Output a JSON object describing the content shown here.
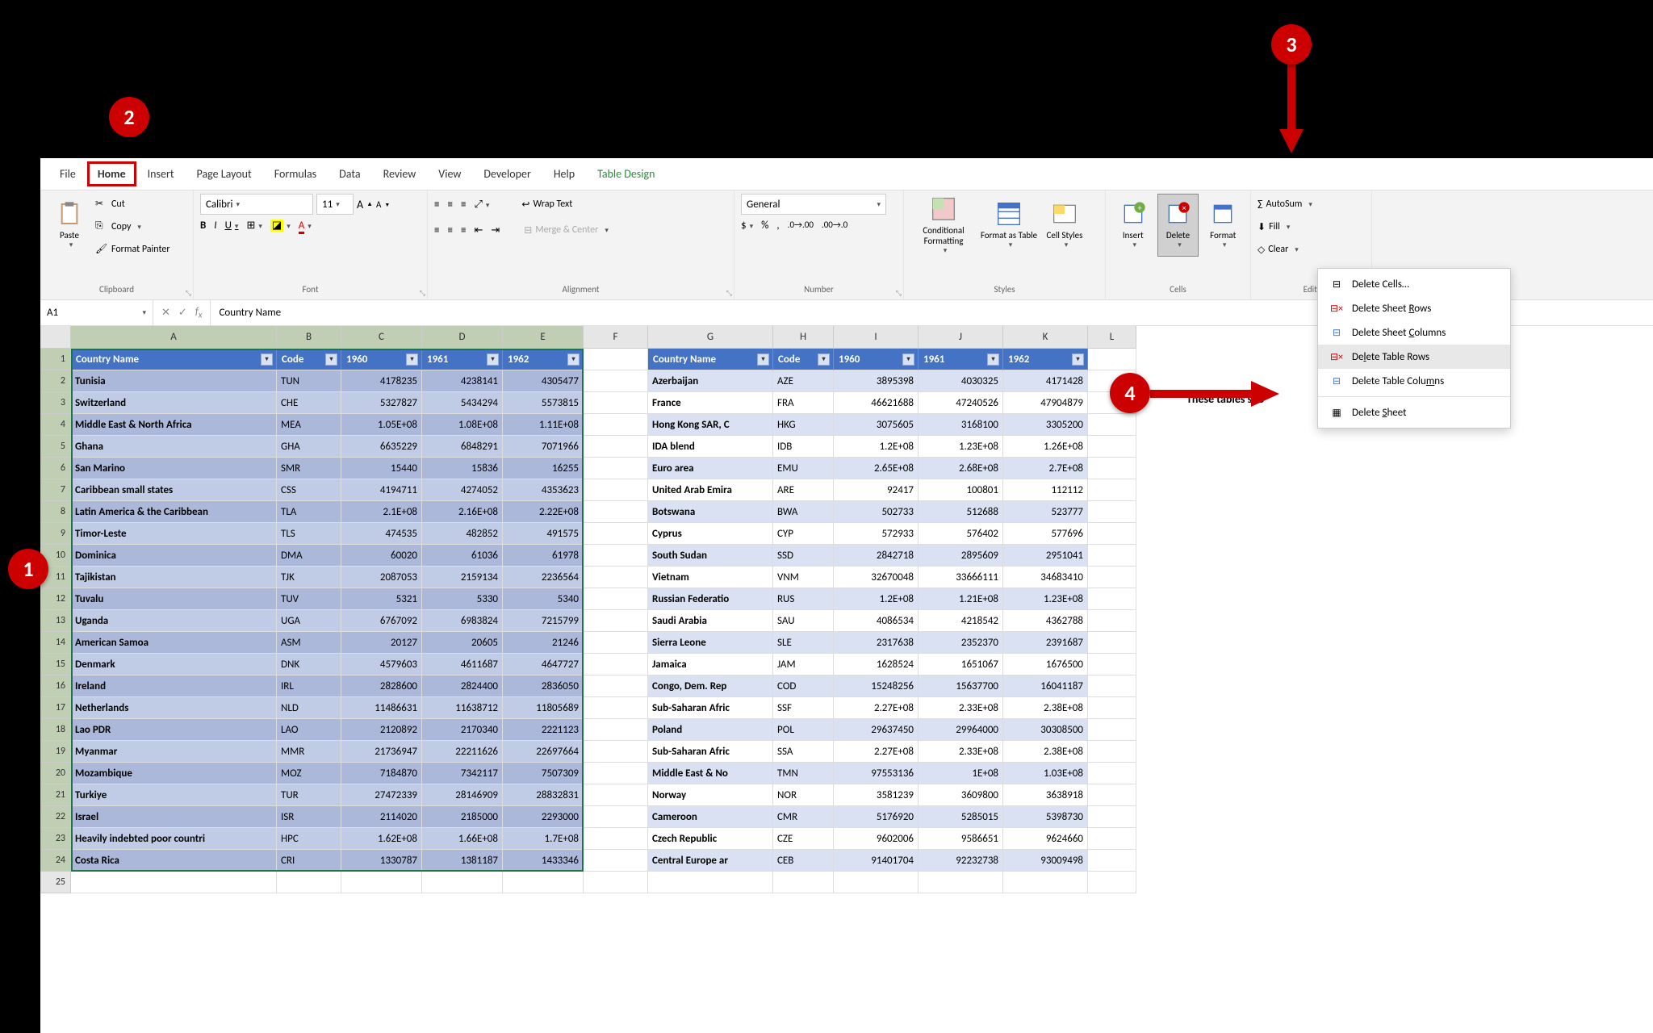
{
  "tabs": {
    "file": "File",
    "home": "Home",
    "insert": "Insert",
    "page_layout": "Page Layout",
    "formulas": "Formulas",
    "data": "Data",
    "review": "Review",
    "view": "View",
    "developer": "Developer",
    "help": "Help",
    "table_design": "Table Design"
  },
  "clipboard": {
    "paste": "Paste",
    "cut": "Cut",
    "copy": "Copy",
    "format_painter": "Format Painter",
    "group": "Clipboard"
  },
  "font": {
    "name": "Calibri",
    "size": "11",
    "group": "Font"
  },
  "alignment": {
    "wrap": "Wrap Text",
    "merge": "Merge & Center",
    "group": "Alignment"
  },
  "number": {
    "format": "General",
    "group": "Number"
  },
  "styles": {
    "cond": "Conditional Formatting",
    "asTable": "Format as Table",
    "cellStyles": "Cell Styles",
    "group": "Styles"
  },
  "cells": {
    "insert": "Insert",
    "delete": "Delete",
    "format": "Format"
  },
  "editing": {
    "autosum": "AutoSum",
    "fill": "Fill",
    "clear": "Clear"
  },
  "namebox": "A1",
  "formula": "Country Name",
  "delete_menu": {
    "cells": "Delete Cells…",
    "sheet_rows": "Delete Sheet Rows",
    "sheet_cols": "Delete Sheet Columns",
    "table_rows": "Delete Table Rows",
    "table_cols": "Delete Table Columns",
    "sheet": "Delete Sheet"
  },
  "side_note": "These tables sho",
  "cols_letters": [
    "A",
    "B",
    "C",
    "D",
    "E",
    "F",
    "G",
    "H",
    "I",
    "J",
    "K",
    "L"
  ],
  "table1": {
    "headers": [
      "Country Name",
      "Code",
      "1960",
      "1961",
      "1962"
    ],
    "rows": [
      [
        "Tunisia",
        "TUN",
        "4178235",
        "4238141",
        "4305477"
      ],
      [
        "Switzerland",
        "CHE",
        "5327827",
        "5434294",
        "5573815"
      ],
      [
        "Middle East & North Africa",
        "MEA",
        "1.05E+08",
        "1.08E+08",
        "1.11E+08"
      ],
      [
        "Ghana",
        "GHA",
        "6635229",
        "6848291",
        "7071966"
      ],
      [
        "San Marino",
        "SMR",
        "15440",
        "15836",
        "16255"
      ],
      [
        "Caribbean small states",
        "CSS",
        "4194711",
        "4274052",
        "4353623"
      ],
      [
        "Latin America & the Caribbean",
        "TLA",
        "2.1E+08",
        "2.16E+08",
        "2.22E+08"
      ],
      [
        "Timor-Leste",
        "TLS",
        "474535",
        "482852",
        "491575"
      ],
      [
        "Dominica",
        "DMA",
        "60020",
        "61036",
        "61978"
      ],
      [
        "Tajikistan",
        "TJK",
        "2087053",
        "2159134",
        "2236564"
      ],
      [
        "Tuvalu",
        "TUV",
        "5321",
        "5330",
        "5340"
      ],
      [
        "Uganda",
        "UGA",
        "6767092",
        "6983824",
        "7215799"
      ],
      [
        "American Samoa",
        "ASM",
        "20127",
        "20605",
        "21246"
      ],
      [
        "Denmark",
        "DNK",
        "4579603",
        "4611687",
        "4647727"
      ],
      [
        "Ireland",
        "IRL",
        "2828600",
        "2824400",
        "2836050"
      ],
      [
        "Netherlands",
        "NLD",
        "11486631",
        "11638712",
        "11805689"
      ],
      [
        "Lao PDR",
        "LAO",
        "2120892",
        "2170340",
        "2221123"
      ],
      [
        "Myanmar",
        "MMR",
        "21736947",
        "22211626",
        "22697664"
      ],
      [
        "Mozambique",
        "MOZ",
        "7184870",
        "7342117",
        "7507309"
      ],
      [
        "Turkiye",
        "TUR",
        "27472339",
        "28146909",
        "28832831"
      ],
      [
        "Israel",
        "ISR",
        "2114020",
        "2185000",
        "2293000"
      ],
      [
        "Heavily indebted poor countri",
        "HPC",
        "1.62E+08",
        "1.66E+08",
        "1.7E+08"
      ],
      [
        "Costa Rica",
        "CRI",
        "1330787",
        "1381187",
        "1433346"
      ]
    ]
  },
  "table2": {
    "headers": [
      "Country Name",
      "Code",
      "1960",
      "1961",
      "1962"
    ],
    "rows": [
      [
        "Azerbaijan",
        "AZE",
        "3895398",
        "4030325",
        "4171428"
      ],
      [
        "France",
        "FRA",
        "46621688",
        "47240526",
        "47904879"
      ],
      [
        "Hong Kong SAR, C",
        "HKG",
        "3075605",
        "3168100",
        "3305200"
      ],
      [
        "IDA blend",
        "IDB",
        "1.2E+08",
        "1.23E+08",
        "1.26E+08"
      ],
      [
        "Euro area",
        "EMU",
        "2.65E+08",
        "2.68E+08",
        "2.7E+08"
      ],
      [
        "United Arab Emira",
        "ARE",
        "92417",
        "100801",
        "112112"
      ],
      [
        "Botswana",
        "BWA",
        "502733",
        "512688",
        "523777"
      ],
      [
        "Cyprus",
        "CYP",
        "572933",
        "576402",
        "577696"
      ],
      [
        "South Sudan",
        "SSD",
        "2842718",
        "2895609",
        "2951041"
      ],
      [
        "Vietnam",
        "VNM",
        "32670048",
        "33666111",
        "34683410"
      ],
      [
        "Russian Federatio",
        "RUS",
        "1.2E+08",
        "1.21E+08",
        "1.23E+08"
      ],
      [
        "Saudi Arabia",
        "SAU",
        "4086534",
        "4218542",
        "4362788"
      ],
      [
        "Sierra Leone",
        "SLE",
        "2317638",
        "2352370",
        "2391687"
      ],
      [
        "Jamaica",
        "JAM",
        "1628524",
        "1651067",
        "1676500"
      ],
      [
        "Congo, Dem. Rep",
        "COD",
        "15248256",
        "15637700",
        "16041187"
      ],
      [
        "Sub-Saharan Afric",
        "SSF",
        "2.27E+08",
        "2.33E+08",
        "2.38E+08"
      ],
      [
        "Poland",
        "POL",
        "29637450",
        "29964000",
        "30308500"
      ],
      [
        "Sub-Saharan Afric",
        "SSA",
        "2.27E+08",
        "2.33E+08",
        "2.38E+08"
      ],
      [
        "Middle East & No",
        "TMN",
        "97553136",
        "1E+08",
        "1.03E+08"
      ],
      [
        "Norway",
        "NOR",
        "3581239",
        "3609800",
        "3638918"
      ],
      [
        "Cameroon",
        "CMR",
        "5176920",
        "5285015",
        "5398730"
      ],
      [
        "Czech Republic",
        "CZE",
        "9602006",
        "9586651",
        "9624660"
      ],
      [
        "Central Europe ar",
        "CEB",
        "91401704",
        "92232738",
        "93009498"
      ]
    ]
  },
  "col_widths": {
    "t1": [
      255,
      80,
      100,
      100,
      100
    ],
    "t2": [
      155,
      75,
      105,
      105,
      105
    ],
    "blankF": 80,
    "blankL": 60
  }
}
